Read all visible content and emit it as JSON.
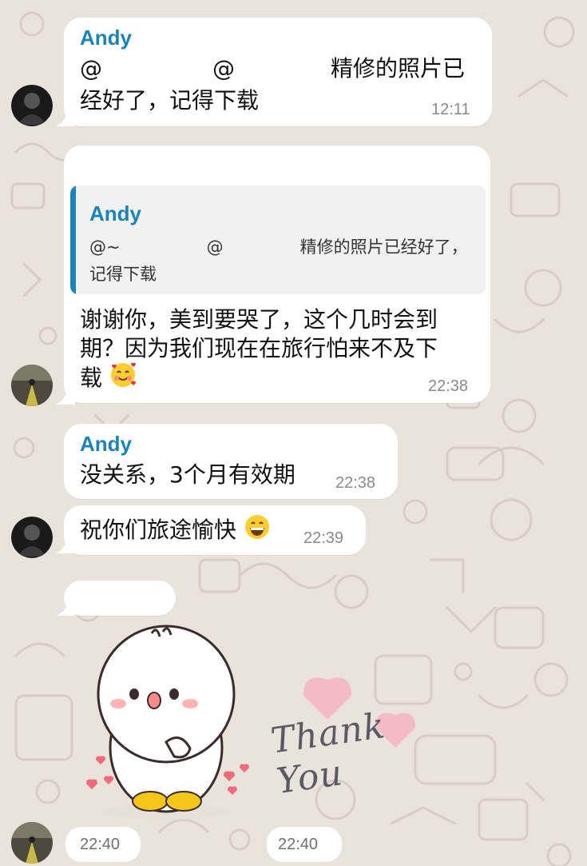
{
  "messages": [
    {
      "sender": "Andy",
      "line1_a": "@",
      "line1_b": "@",
      "line1_c": "精修的照片已",
      "line2": "经好了，记得下载",
      "time": "12:11"
    },
    {
      "quote_sender": "Andy",
      "quote_line1_a": "@~",
      "quote_line1_b": "@",
      "quote_line1_c": "精修的照片已经好了，",
      "quote_line2": "记得下载",
      "line1": "谢谢你，美到要哭了，这个几时会到",
      "line2": "期？因为我们现在在旅行怕来不及下",
      "line3": "载",
      "emoji": "smiling-face-with-hearts",
      "time": "22:38"
    },
    {
      "sender": "Andy",
      "text": "没关系，3个月有效期",
      "time": "22:38"
    },
    {
      "text": "祝你们旅途愉快",
      "emoji": "grinning-face",
      "time": "22:39"
    },
    {
      "sticker_text": "Thank You",
      "time_left": "22:40",
      "time_right": "22:40"
    }
  ],
  "colors": {
    "name": "#1b83ba",
    "bubble": "#ffffff",
    "background": "#e9e3dc",
    "time": "#8a8a8a"
  }
}
